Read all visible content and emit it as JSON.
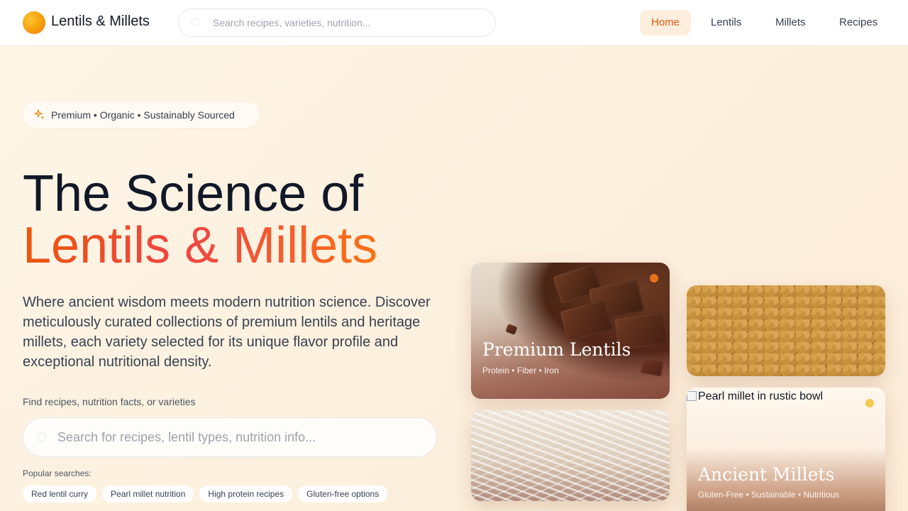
{
  "header": {
    "brand": "Lentils & Millets",
    "search_placeholder": "Search recipes, varieties, nutrition...",
    "nav": [
      {
        "label": "Home",
        "active": true
      },
      {
        "label": "Lentils",
        "active": false
      },
      {
        "label": "Millets",
        "active": false
      },
      {
        "label": "Recipes",
        "active": false
      }
    ]
  },
  "hero": {
    "badge": "Premium • Organic • Sustainably Sourced",
    "title_line1": "The Science of",
    "title_line2": "Lentils & Millets",
    "lead": "Where ancient wisdom meets modern nutrition science. Discover meticulously curated collections of premium lentils and heritage millets, each variety selected for its unique flavor profile and exceptional nutritional density.",
    "find_label": "Find recipes, nutrition facts, or varieties",
    "search_placeholder": "Search for recipes, lentil types, nutrition info...",
    "popular_label": "Popular searches:",
    "popular": [
      "Red lentil curry",
      "Pearl millet nutrition",
      "High protein recipes",
      "Gluten-free options"
    ]
  },
  "cards": {
    "lentils": {
      "title": "Premium Lentils",
      "tags": "Protein • Fiber • Iron"
    },
    "millets": {
      "title": "Ancient Millets",
      "tags": "Gluten-Free • Sustainable • Nutritious",
      "alt": "Pearl millet in rustic bowl"
    }
  },
  "colors": {
    "accent": "#ea580c",
    "gradient_start": "#ea580c",
    "gradient_mid": "#ef4444",
    "gradient_end": "#f97316",
    "marker_orange": "#e8731c",
    "marker_yellow": "#f2c94c"
  }
}
